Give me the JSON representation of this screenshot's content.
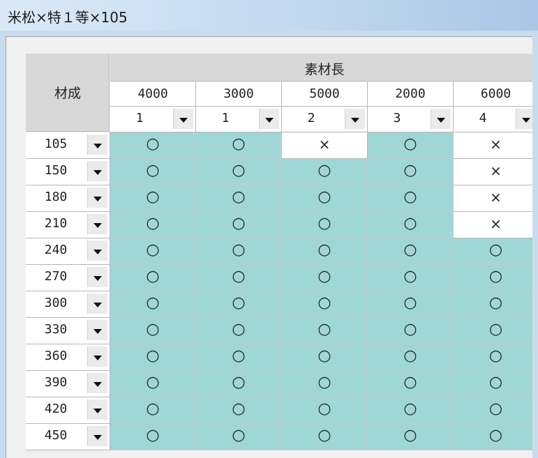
{
  "window": {
    "title": "米松×特１等×105"
  },
  "grid": {
    "row_header_label": "材成",
    "column_group_label": "素材長",
    "columns": [
      {
        "length": "4000",
        "selector": "1"
      },
      {
        "length": "3000",
        "selector": "1"
      },
      {
        "length": "5000",
        "selector": "2"
      },
      {
        "length": "2000",
        "selector": "3"
      },
      {
        "length": "6000",
        "selector": "4"
      }
    ],
    "rows": [
      {
        "size": "105",
        "marks": [
          "○",
          "○",
          "×",
          "○",
          "×"
        ]
      },
      {
        "size": "150",
        "marks": [
          "○",
          "○",
          "○",
          "○",
          "×"
        ]
      },
      {
        "size": "180",
        "marks": [
          "○",
          "○",
          "○",
          "○",
          "×"
        ]
      },
      {
        "size": "210",
        "marks": [
          "○",
          "○",
          "○",
          "○",
          "×"
        ]
      },
      {
        "size": "240",
        "marks": [
          "○",
          "○",
          "○",
          "○",
          "○"
        ]
      },
      {
        "size": "270",
        "marks": [
          "○",
          "○",
          "○",
          "○",
          "○"
        ]
      },
      {
        "size": "300",
        "marks": [
          "○",
          "○",
          "○",
          "○",
          "○"
        ]
      },
      {
        "size": "330",
        "marks": [
          "○",
          "○",
          "○",
          "○",
          "○"
        ]
      },
      {
        "size": "360",
        "marks": [
          "○",
          "○",
          "○",
          "○",
          "○"
        ]
      },
      {
        "size": "390",
        "marks": [
          "○",
          "○",
          "○",
          "○",
          "○"
        ]
      },
      {
        "size": "420",
        "marks": [
          "○",
          "○",
          "○",
          "○",
          "○"
        ]
      },
      {
        "size": "450",
        "marks": [
          "○",
          "○",
          "○",
          "○",
          "○"
        ]
      }
    ]
  },
  "colors": {
    "available": "#9fd7d6",
    "unavailable": "#ffffff",
    "header": "#d8d8d8"
  },
  "icons": {
    "dropdown": "chevron-down-icon"
  }
}
